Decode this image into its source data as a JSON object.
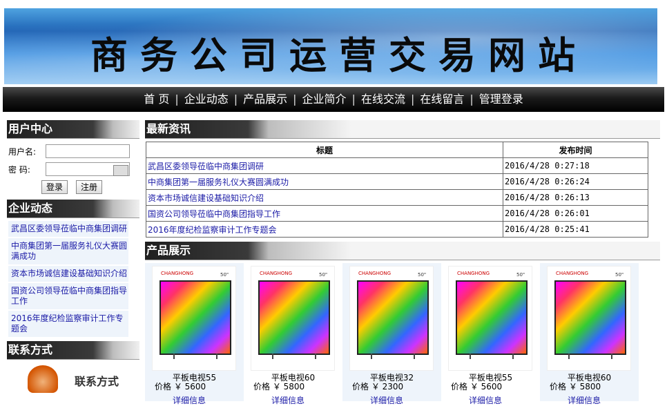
{
  "banner": {
    "title": "商务公司运营交易网站"
  },
  "nav": [
    "首 页",
    "企业动态",
    "产品展示",
    "企业简介",
    "在线交流",
    "在线留言",
    "管理登录"
  ],
  "user_center": {
    "title": "用户中心",
    "username_label": "用户名:",
    "password_label": "密 码:",
    "login_btn": "登录",
    "register_btn": "注册"
  },
  "company_news": {
    "title": "企业动态",
    "items": [
      "武昌区委领导莅临中商集团调研",
      "中商集团第一届服务礼仪大赛圆满成功",
      "资本市场诚信建设基础知识介绍",
      "国资公司领导莅临中商集团指导工作",
      "2016年度纪检监察审计工作专题会"
    ]
  },
  "contact": {
    "title": "联系方式",
    "label": "联系方式"
  },
  "latest_news": {
    "title": "最新资讯",
    "headers": [
      "标题",
      "发布时间"
    ],
    "rows": [
      [
        "武昌区委领导莅临中商集团调研",
        "2016/4/28 0:27:18"
      ],
      [
        "中商集团第一届服务礼仪大赛圆满成功",
        "2016/4/28 0:26:24"
      ],
      [
        "资本市场诚信建设基础知识介绍",
        "2016/4/28 0:26:13"
      ],
      [
        "国资公司领导莅临中商集团指导工作",
        "2016/4/28 0:26:01"
      ],
      [
        "2016年度纪检监察审计工作专题会",
        "2016/4/28 0:25:41"
      ]
    ]
  },
  "products": {
    "title": "产品展示",
    "price_label": "价格 ￥",
    "link_label": "详细信息",
    "brand": "CHANGHONG",
    "items": [
      {
        "name": "平板电视55",
        "price": "5600",
        "size": "50\""
      },
      {
        "name": "平板电视60",
        "price": "5800",
        "size": "50\""
      },
      {
        "name": "平板电视32",
        "price": "2300",
        "size": "50\""
      },
      {
        "name": "平板电视55",
        "price": "5600",
        "size": "50\""
      },
      {
        "name": "平板电视60",
        "price": "5800",
        "size": "50\""
      }
    ]
  }
}
